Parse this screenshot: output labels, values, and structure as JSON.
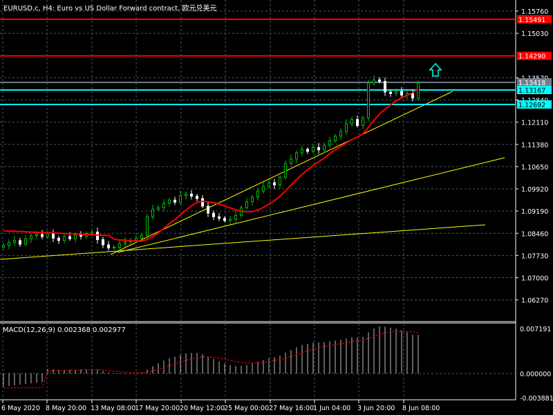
{
  "window": {
    "title": "EURUSD.c, H4:  Euro vs US Dollar Forward contract, 欧元兑美元"
  },
  "colors": {
    "background": "#000000",
    "grid": "#4a5866",
    "axis": "#ffffff",
    "bull": "#00c000",
    "bear": "#ffffff",
    "ma": "#ff0000",
    "trend": "#ffff00",
    "macd": "#c0c0c0",
    "signal": "#ff0000"
  },
  "chart_data": {
    "type": "candlestick",
    "symbol": "EURUSD.c",
    "timeframe": "H4",
    "price_axis": {
      "min": 1.056,
      "max": 1.1603,
      "ticks": [
        "1.15760",
        "1.15030",
        "1.13570",
        "1.12840",
        "1.12110",
        "1.11380",
        "1.10650",
        "1.09920",
        "1.09190",
        "1.08460",
        "1.07730",
        "1.07000",
        "1.06270"
      ]
    },
    "time_axis": {
      "labels": [
        "6 May 2020",
        "8 May 20:00",
        "13 May 08:00",
        "17 May 20:00",
        "20 May 12:00",
        "25 May 00:00",
        "27 May 16:00",
        "1 Jun 04:00",
        "3 Jun 20:00",
        "8 Jun 08:00"
      ]
    },
    "closes": [
      1.0806,
      1.0815,
      1.0822,
      1.081,
      1.0828,
      1.0838,
      1.0842,
      1.0835,
      1.0845,
      1.083,
      1.0822,
      1.0835,
      1.0828,
      1.084,
      1.0836,
      1.0845,
      1.085,
      1.0825,
      1.0808,
      1.0798,
      1.08,
      1.0812,
      1.0818,
      1.0822,
      1.083,
      1.084,
      1.09,
      1.0925,
      1.093,
      1.0945,
      1.0955,
      1.0948,
      1.097,
      1.0975,
      1.0968,
      1.096,
      1.0935,
      1.0912,
      1.09,
      1.0895,
      1.0888,
      1.0892,
      1.0905,
      1.093,
      1.095,
      1.0965,
      1.0985,
      1.1,
      1.1012,
      1.1005,
      1.103,
      1.1075,
      1.109,
      1.111,
      1.1122,
      1.1115,
      1.1128,
      1.112,
      1.1135,
      1.115,
      1.1165,
      1.118,
      1.1205,
      1.122,
      1.12,
      1.1225,
      1.134,
      1.135,
      1.1345,
      1.131,
      1.1305,
      1.1312,
      1.13,
      1.1305,
      1.129,
      1.134
    ],
    "price_lines": [
      {
        "label": "1.15491",
        "value": 1.15491,
        "color": "#ff0000"
      },
      {
        "label": "1.14290",
        "value": 1.1429,
        "color": "#ff0000"
      },
      {
        "label": "1.13418",
        "value": 1.13418,
        "color": "#708090"
      },
      {
        "label": "1.13167",
        "value": 1.13167,
        "color": "#00ffff"
      },
      {
        "label": "1.12692",
        "value": 1.12692,
        "color": "#00ffff"
      }
    ],
    "macd": {
      "label": "MACD(12,26,9) 0.002368 0.002977",
      "max": 0.007191,
      "min": -0.003881,
      "ticks": [
        "0.007191",
        "0.000000",
        "-0.003881"
      ]
    }
  }
}
